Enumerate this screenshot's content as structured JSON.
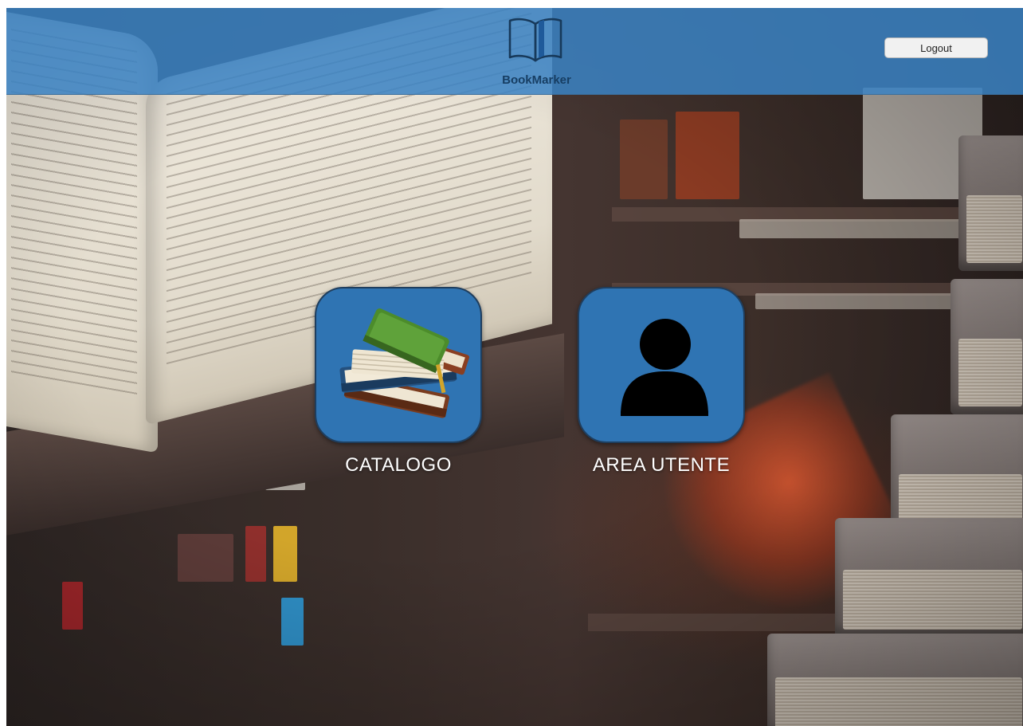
{
  "header": {
    "brand": "BookMarker",
    "logout_label": "Logout"
  },
  "tiles": [
    {
      "label": "CATALOGO",
      "icon": "books-stack-icon"
    },
    {
      "label": "AREA UTENTE",
      "icon": "user-icon"
    }
  ],
  "colors": {
    "header": "#3a82c4",
    "tile": "#2f74b3",
    "tile_border": "#1f3e5e",
    "logout_bg": "#f1f1f1"
  }
}
